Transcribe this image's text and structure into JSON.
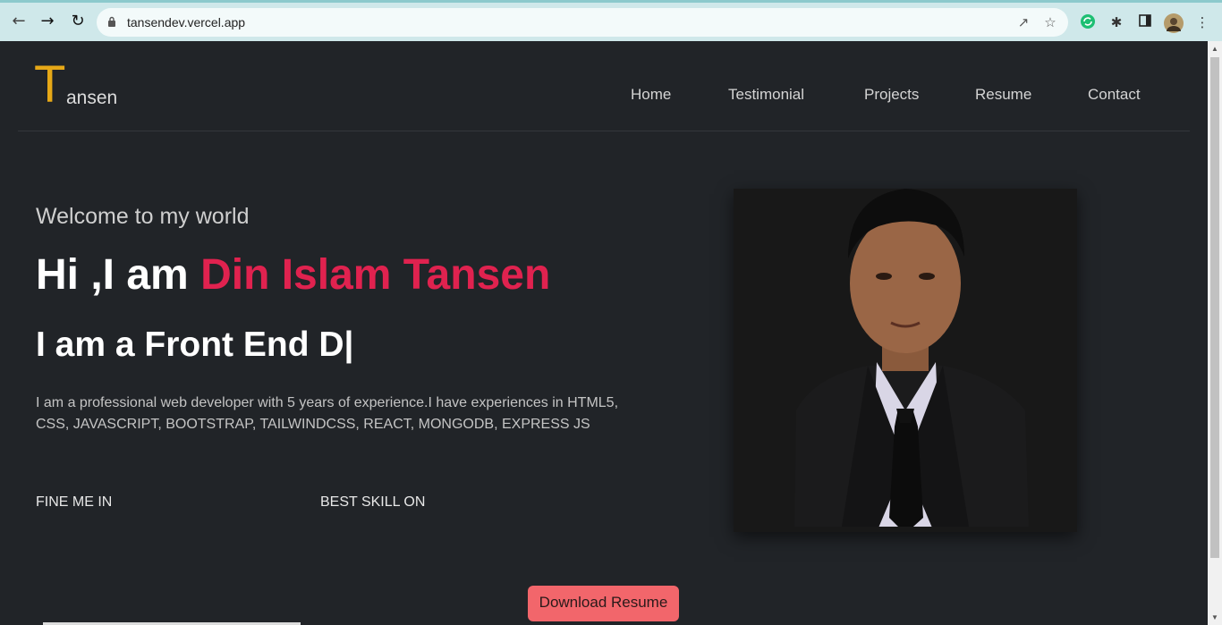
{
  "browser": {
    "url": "tansendev.vercel.app",
    "back_icon": "arrow-left",
    "forward_icon": "arrow-right",
    "reload_icon": "reload"
  },
  "logo": {
    "initial": "T",
    "rest": "ansen"
  },
  "nav": [
    {
      "label": "Home"
    },
    {
      "label": "Testimonial"
    },
    {
      "label": "Projects"
    },
    {
      "label": "Resume"
    },
    {
      "label": "Contact"
    }
  ],
  "hero": {
    "welcome": "Welcome to my world",
    "greeting": "Hi ,I am ",
    "name": "Din Islam Tansen",
    "typed": "I am a Front End D|",
    "bio": "I am a professional web developer with 5 years of experience.I have experiences in HTML5, CSS, JAVASCRIPT, BOOTSTRAP, TAILWINDCSS, REACT, MONGODB, EXPRESS JS",
    "find_me": "FINE ME IN",
    "best_skill": "BEST SKILL ON",
    "download": "Download Resume"
  },
  "colors": {
    "background": "#212428",
    "accent_name": "#e0224f",
    "logo_accent": "#e6a817",
    "button": "#f2666b"
  }
}
